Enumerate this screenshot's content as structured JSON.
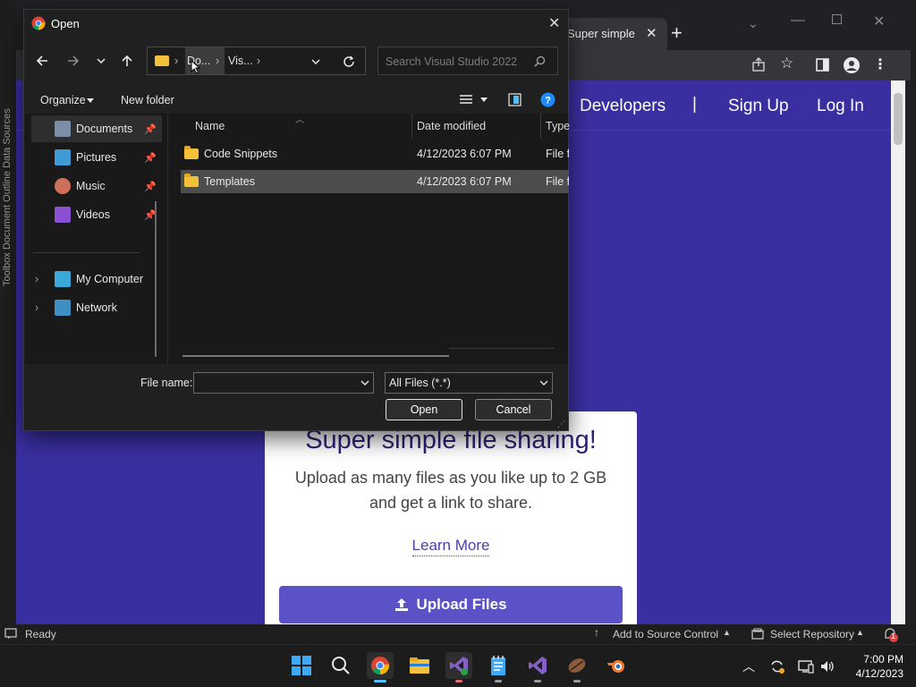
{
  "vs": {
    "side_tabs": "Toolbox   Document Outline   Data Sources",
    "status_ready": "Ready",
    "add_source_control": "Add to Source Control",
    "select_repository": "Select Repository",
    "notification_count": "1"
  },
  "browser": {
    "tab_title": "Super simple",
    "nav_links": [
      "Developers",
      "|",
      "Sign Up",
      "Log In"
    ]
  },
  "site": {
    "card_title": "Super simple file sharing!",
    "card_desc": "Upload as many files as you like up to 2 GB and get a link to share.",
    "learn_more": "Learn More",
    "upload_button": "Upload Files"
  },
  "dialog": {
    "title": "Open",
    "breadcrumb": [
      "Do...",
      "Vis..."
    ],
    "search_placeholder": "Search Visual Studio 2022",
    "organize_label": "Organize",
    "new_folder_label": "New folder",
    "nav_items": [
      {
        "label": "Documents",
        "icon": "documents-icon",
        "pinned": true
      },
      {
        "label": "Pictures",
        "icon": "pictures-icon",
        "pinned": true
      },
      {
        "label": "Music",
        "icon": "music-icon",
        "pinned": true
      },
      {
        "label": "Videos",
        "icon": "videos-icon",
        "pinned": true
      },
      {
        "label": "My Computer",
        "icon": "computer-icon",
        "expandable": true
      },
      {
        "label": "Network",
        "icon": "network-icon",
        "expandable": true
      }
    ],
    "columns": [
      "Name",
      "Date modified",
      "Type"
    ],
    "files": [
      {
        "name": "Code Snippets",
        "date": "4/12/2023 6:07 PM",
        "type": "File fo",
        "selected": false
      },
      {
        "name": "Templates",
        "date": "4/12/2023 6:07 PM",
        "type": "File fo",
        "selected": true
      }
    ],
    "file_name_label": "File name:",
    "file_name_value": "",
    "filter_value": "All Files (*.*)",
    "open_button": "Open",
    "cancel_button": "Cancel"
  },
  "taskbar": {
    "time": "7:00 PM",
    "date": "4/12/2023"
  },
  "colors": {
    "site_bg": "#3a2fa0",
    "upload_button": "#5a52c6",
    "dialog_bg": "#202020",
    "selection": "#4d4d4d"
  }
}
